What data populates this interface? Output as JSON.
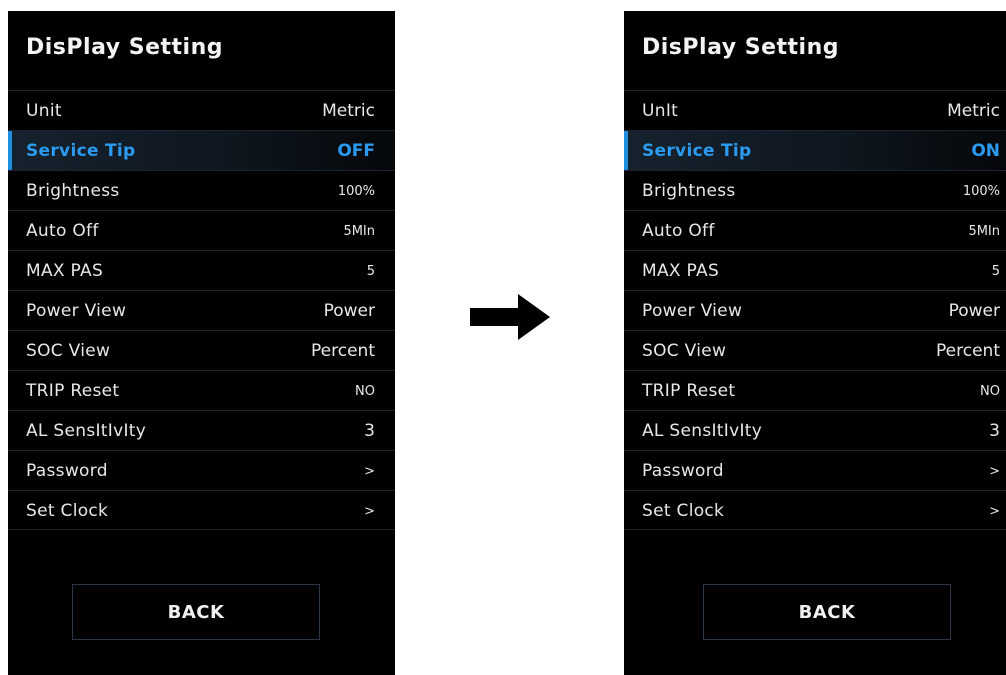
{
  "screens": {
    "before": {
      "title": "DisPlay Setting",
      "rows": [
        {
          "label": "Unit",
          "value": "Metric"
        },
        {
          "label": "Service Tip",
          "value": "OFF"
        },
        {
          "label": "Brightness",
          "value": "100%"
        },
        {
          "label": "Auto Off",
          "value": "5MIn"
        },
        {
          "label": "MAX PAS",
          "value": "5"
        },
        {
          "label": "Power View",
          "value": "Power"
        },
        {
          "label": "SOC View",
          "value": "Percent"
        },
        {
          "label": "TRIP Reset",
          "value": "NO"
        },
        {
          "label": "AL SensItIvIty",
          "value": "3"
        },
        {
          "label": "Password",
          "value": ">"
        },
        {
          "label": "Set Clock",
          "value": ">"
        }
      ],
      "back_label": "BACK"
    },
    "after": {
      "title": "DisPlay Setting",
      "rows": [
        {
          "label": "UnIt",
          "value": "Metric"
        },
        {
          "label": "Service Tip",
          "value": "ON"
        },
        {
          "label": "Brightness",
          "value": "100%"
        },
        {
          "label": "Auto Off",
          "value": "5MIn"
        },
        {
          "label": "MAX PAS",
          "value": "5"
        },
        {
          "label": "Power View",
          "value": "Power"
        },
        {
          "label": "SOC View",
          "value": "Percent"
        },
        {
          "label": "TRIP Reset",
          "value": "NO"
        },
        {
          "label": "AL SensItIvIty",
          "value": "3"
        },
        {
          "label": "Password",
          "value": ">"
        },
        {
          "label": "Set Clock",
          "value": ">"
        }
      ],
      "back_label": "BACK"
    }
  },
  "selected_row": "Service Tip",
  "colors": {
    "accent": "#1e8fe0",
    "screen_bg": "#000000",
    "page_bg": "#ffffff"
  },
  "arrow_icon": "right-arrow-icon"
}
